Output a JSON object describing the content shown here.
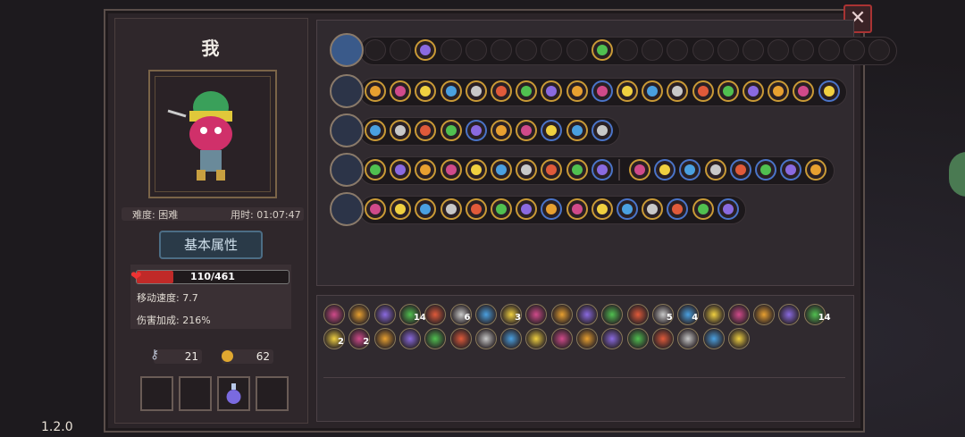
{
  "player": {
    "name": "我"
  },
  "info": {
    "difficulty": "难度: 困难",
    "time": "用时: 01:07:47"
  },
  "tab": {
    "label": "基本属性"
  },
  "stats": {
    "hp_text": "110/461",
    "hp_fraction": 0.239,
    "move_speed": "移动速度: 7.7",
    "damage_bonus": "伤害加成: 216%"
  },
  "resources": {
    "keys": "21",
    "coins": "62"
  },
  "version": "1.2.0",
  "colors": {
    "accent_gold": "#c99a36",
    "hp_red": "#c02a28",
    "blue_ring": "#4a74c8"
  },
  "weapon_rows": [
    {
      "icon": "chest-icon",
      "slots": [
        "e",
        "e",
        "f",
        "e",
        "e",
        "e",
        "e",
        "e",
        "e",
        "f",
        "e",
        "e",
        "e",
        "e",
        "e",
        "e",
        "e",
        "e",
        "e",
        "e",
        "e"
      ]
    },
    {
      "icon": "staff-icon",
      "slots": [
        "f",
        "f",
        "f",
        "f",
        "f",
        "f",
        "f",
        "f",
        "f",
        "b",
        "f",
        "f",
        "f",
        "f",
        "f",
        "f",
        "f",
        "f",
        "b"
      ]
    },
    {
      "icon": "flower-icon",
      "slots": [
        "f",
        "f",
        "f",
        "f",
        "b",
        "f",
        "f",
        "b",
        "f",
        "b"
      ]
    },
    {
      "icon": "crystal-staff-icon",
      "slots": [
        "f",
        "f",
        "f",
        "f",
        "f",
        "f",
        "f",
        "f",
        "f",
        "b",
        "|",
        "f",
        "b",
        "b",
        "f",
        "b",
        "b",
        "b",
        "f"
      ]
    },
    {
      "icon": "star-staff-icon",
      "slots": [
        "f",
        "f",
        "f",
        "f",
        "f",
        "f",
        "f",
        "b",
        "f",
        "f",
        "b",
        "f",
        "b",
        "f",
        "b"
      ]
    }
  ],
  "inventory": {
    "row1": [
      {
        "icon": "squid-icon",
        "count": ""
      },
      {
        "icon": "clover-icon",
        "count": ""
      },
      {
        "icon": "magnifier-icon",
        "count": ""
      },
      {
        "icon": "arrow-icon",
        "count": "14"
      },
      {
        "icon": "ghost-icon",
        "count": ""
      },
      {
        "icon": "bow-icon",
        "count": "6"
      },
      {
        "icon": "feather-icon",
        "count": ""
      },
      {
        "icon": "crossbow-icon",
        "count": "3"
      },
      {
        "icon": "pickaxe-icon",
        "count": ""
      },
      {
        "icon": "red-gem-icon",
        "count": ""
      },
      {
        "icon": "runner-icon",
        "count": ""
      },
      {
        "icon": "cloak-icon",
        "count": ""
      },
      {
        "icon": "cube-icon",
        "count": ""
      },
      {
        "icon": "arrows-icon",
        "count": "5"
      },
      {
        "icon": "dragon-icon",
        "count": "4"
      },
      {
        "icon": "wings-icon",
        "count": ""
      },
      {
        "icon": "leaf-icon",
        "count": ""
      },
      {
        "icon": "snake-icon",
        "count": ""
      },
      {
        "icon": "spear-icon",
        "count": ""
      },
      {
        "icon": "bolt-arrow-icon",
        "count": "14"
      }
    ],
    "row2": [
      {
        "icon": "red-orb-icon",
        "count": "2"
      },
      {
        "icon": "hook-icon",
        "count": "2"
      },
      {
        "icon": "totem-icon",
        "count": ""
      },
      {
        "icon": "bird-icon",
        "count": ""
      },
      {
        "icon": "demon-icon",
        "count": ""
      },
      {
        "icon": "vine-icon",
        "count": ""
      },
      {
        "icon": "shield-icon",
        "count": ""
      },
      {
        "icon": "star-gem-icon",
        "count": ""
      },
      {
        "icon": "dove-icon",
        "count": ""
      },
      {
        "icon": "heart-icon",
        "count": ""
      },
      {
        "icon": "glove-icon",
        "count": ""
      },
      {
        "icon": "hood-icon",
        "count": ""
      },
      {
        "icon": "spider-icon",
        "count": ""
      },
      {
        "icon": "teeth-icon",
        "count": ""
      },
      {
        "icon": "sword-icon",
        "count": ""
      },
      {
        "icon": "shield-purple-icon",
        "count": ""
      },
      {
        "icon": "claw-icon",
        "count": ""
      }
    ]
  }
}
